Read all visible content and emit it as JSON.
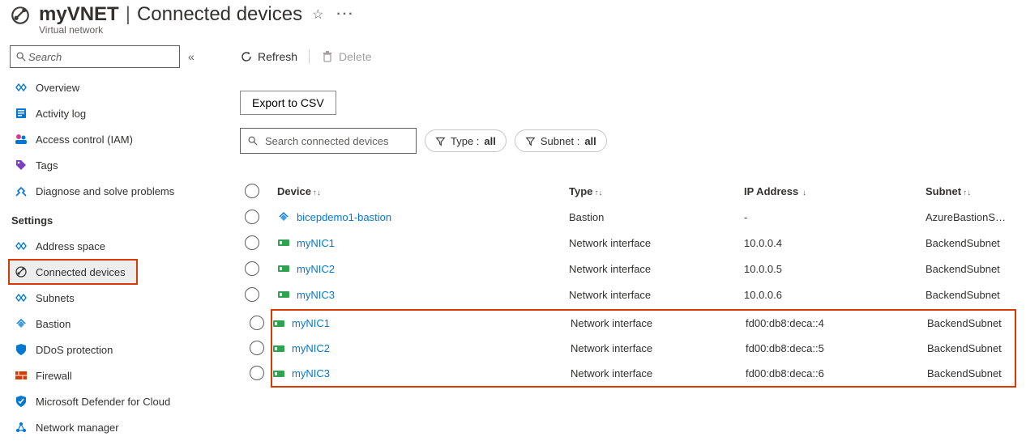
{
  "header": {
    "resource_name": "myVNET",
    "page_title": "Connected devices",
    "subtitle": "Virtual network"
  },
  "sidebar": {
    "search_placeholder": "Search",
    "items": [
      {
        "id": "overview",
        "label": "Overview",
        "icon": "vnet"
      },
      {
        "id": "activity",
        "label": "Activity log",
        "icon": "log"
      },
      {
        "id": "iam",
        "label": "Access control (IAM)",
        "icon": "iam"
      },
      {
        "id": "tags",
        "label": "Tags",
        "icon": "tag"
      },
      {
        "id": "diagnose",
        "label": "Diagnose and solve problems",
        "icon": "tools"
      }
    ],
    "settings_label": "Settings",
    "settings": [
      {
        "id": "address",
        "label": "Address space",
        "icon": "vnet"
      },
      {
        "id": "connected",
        "label": "Connected devices",
        "icon": "connected",
        "selected": true,
        "highlighted": true
      },
      {
        "id": "subnets",
        "label": "Subnets",
        "icon": "vnet"
      },
      {
        "id": "bastion",
        "label": "Bastion",
        "icon": "bastion"
      },
      {
        "id": "ddos",
        "label": "DDoS protection",
        "icon": "shield"
      },
      {
        "id": "firewall",
        "label": "Firewall",
        "icon": "firewall"
      },
      {
        "id": "defender",
        "label": "Microsoft Defender for Cloud",
        "icon": "defender"
      },
      {
        "id": "netmgr",
        "label": "Network manager",
        "icon": "netmgr"
      }
    ]
  },
  "toolbar": {
    "refresh": "Refresh",
    "delete": "Delete",
    "export_csv": "Export to CSV",
    "search_placeholder": "Search connected devices",
    "filter_type_label": "Type :",
    "filter_type_value": "all",
    "filter_subnet_label": "Subnet :",
    "filter_subnet_value": "all"
  },
  "table": {
    "columns": {
      "device": "Device",
      "type": "Type",
      "ip": "IP Address",
      "subnet": "Subnet"
    },
    "rows": [
      {
        "device": "bicepdemo1-bastion",
        "icon": "bastion",
        "type": "Bastion",
        "ip": "-",
        "subnet": "AzureBastionSubnet",
        "hl": false
      },
      {
        "device": "myNIC1",
        "icon": "nic",
        "type": "Network interface",
        "ip": "10.0.0.4",
        "subnet": "BackendSubnet",
        "hl": false
      },
      {
        "device": "myNIC2",
        "icon": "nic",
        "type": "Network interface",
        "ip": "10.0.0.5",
        "subnet": "BackendSubnet",
        "hl": false
      },
      {
        "device": "myNIC3",
        "icon": "nic",
        "type": "Network interface",
        "ip": "10.0.0.6",
        "subnet": "BackendSubnet",
        "hl": false
      },
      {
        "device": "myNIC1",
        "icon": "nic",
        "type": "Network interface",
        "ip": "fd00:db8:deca::4",
        "subnet": "BackendSubnet",
        "hl": true
      },
      {
        "device": "myNIC2",
        "icon": "nic",
        "type": "Network interface",
        "ip": "fd00:db8:deca::5",
        "subnet": "BackendSubnet",
        "hl": true
      },
      {
        "device": "myNIC3",
        "icon": "nic",
        "type": "Network interface",
        "ip": "fd00:db8:deca::6",
        "subnet": "BackendSubnet",
        "hl": true
      }
    ]
  }
}
